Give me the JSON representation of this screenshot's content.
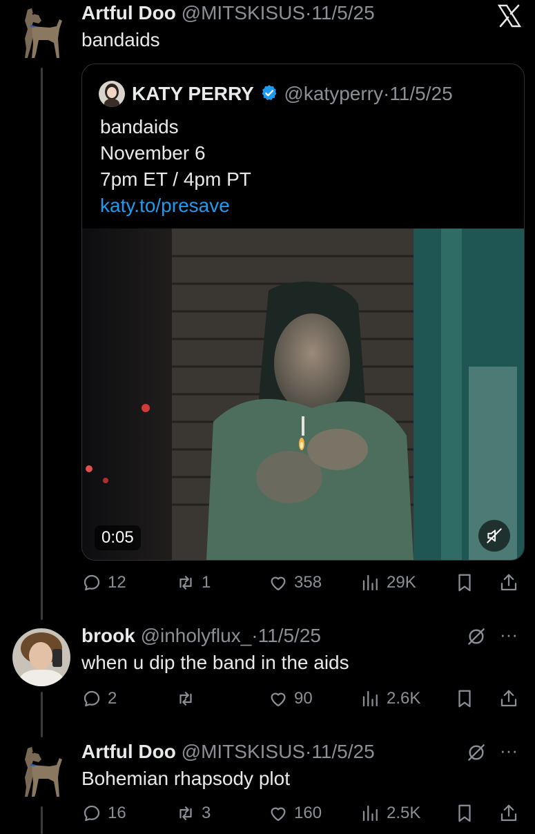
{
  "close_icon_label": "X",
  "tweet1": {
    "name": "Artful Doo",
    "handle": "@MITSKISUS",
    "sep": "·",
    "date": "11/5/25",
    "text": "bandaids",
    "quote": {
      "name": "KATY PERRY",
      "handle": "@katyperry",
      "sep": "·",
      "date": "11/5/25",
      "lines": [
        "bandaids",
        "November 6",
        "7pm ET / 4pm PT"
      ],
      "link": "katy.to/presave",
      "video_time": "0:05"
    },
    "actions": {
      "replies": "12",
      "reposts": "1",
      "likes": "358",
      "views": "29K"
    }
  },
  "tweet2": {
    "name": "brook",
    "handle": "@inholyflux_",
    "sep": "·",
    "date": "11/5/25",
    "text": "when u dip the band in the aids",
    "more": "···",
    "actions": {
      "replies": "2",
      "reposts": "",
      "likes": "90",
      "views": "2.6K"
    }
  },
  "tweet3": {
    "name": "Artful Doo",
    "handle": "@MITSKISUS",
    "sep": "·",
    "date": "11/5/25",
    "text": "Bohemian rhapsody plot",
    "more": "···",
    "actions": {
      "replies": "16",
      "reposts": "3",
      "likes": "160",
      "views": "2.5K"
    }
  },
  "colors": {
    "accent": "#1d9bf0",
    "muted": "#8b9096",
    "background": "#000000",
    "text": "#e7e9ea"
  }
}
